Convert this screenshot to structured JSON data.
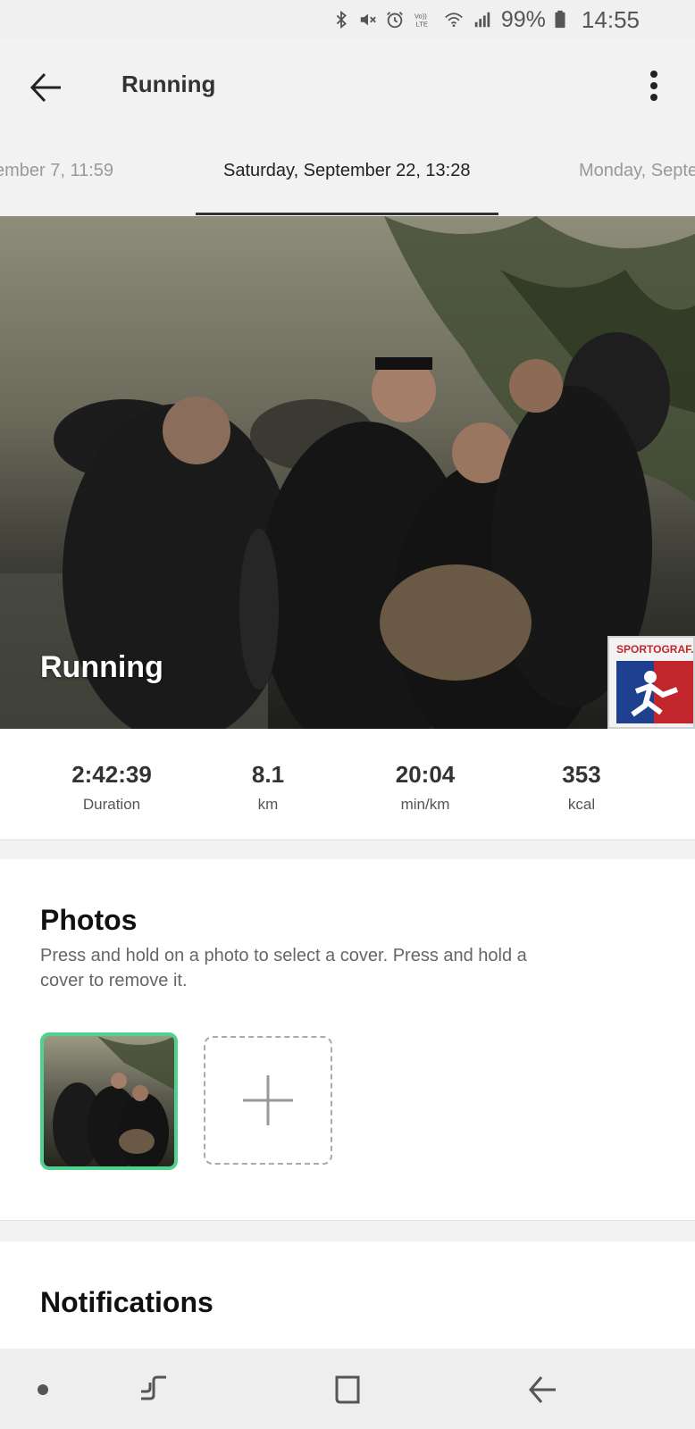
{
  "status_bar": {
    "battery": "99%",
    "time": "14:55",
    "icons": [
      "bluetooth-icon",
      "mute-icon",
      "alarm-icon",
      "volte-icon",
      "wifi-icon",
      "signal-icon",
      "battery-icon"
    ],
    "volte_label": "Vo)) LTE"
  },
  "app_bar": {
    "title": "Running"
  },
  "tabs": [
    {
      "label": "ember 7, 11:59"
    },
    {
      "label": "Saturday, September 22, 13:28"
    },
    {
      "label": "Monday, Septe"
    }
  ],
  "cover": {
    "title": "Running",
    "watermark": "SPORTOGRAF.C"
  },
  "stats": [
    {
      "value": "2:42:39",
      "label": "Duration"
    },
    {
      "value": "8.1",
      "label": "km"
    },
    {
      "value": "20:04",
      "label": "min/km"
    },
    {
      "value": "353",
      "label": "kcal"
    }
  ],
  "photos": {
    "title": "Photos",
    "description": "Press and hold on a photo to select a cover. Press and hold a cover to remove it."
  },
  "notifications": {
    "title": "Notifications"
  },
  "colors": {
    "accent_green": "#4ed28e",
    "background": "#f2f2f2"
  }
}
